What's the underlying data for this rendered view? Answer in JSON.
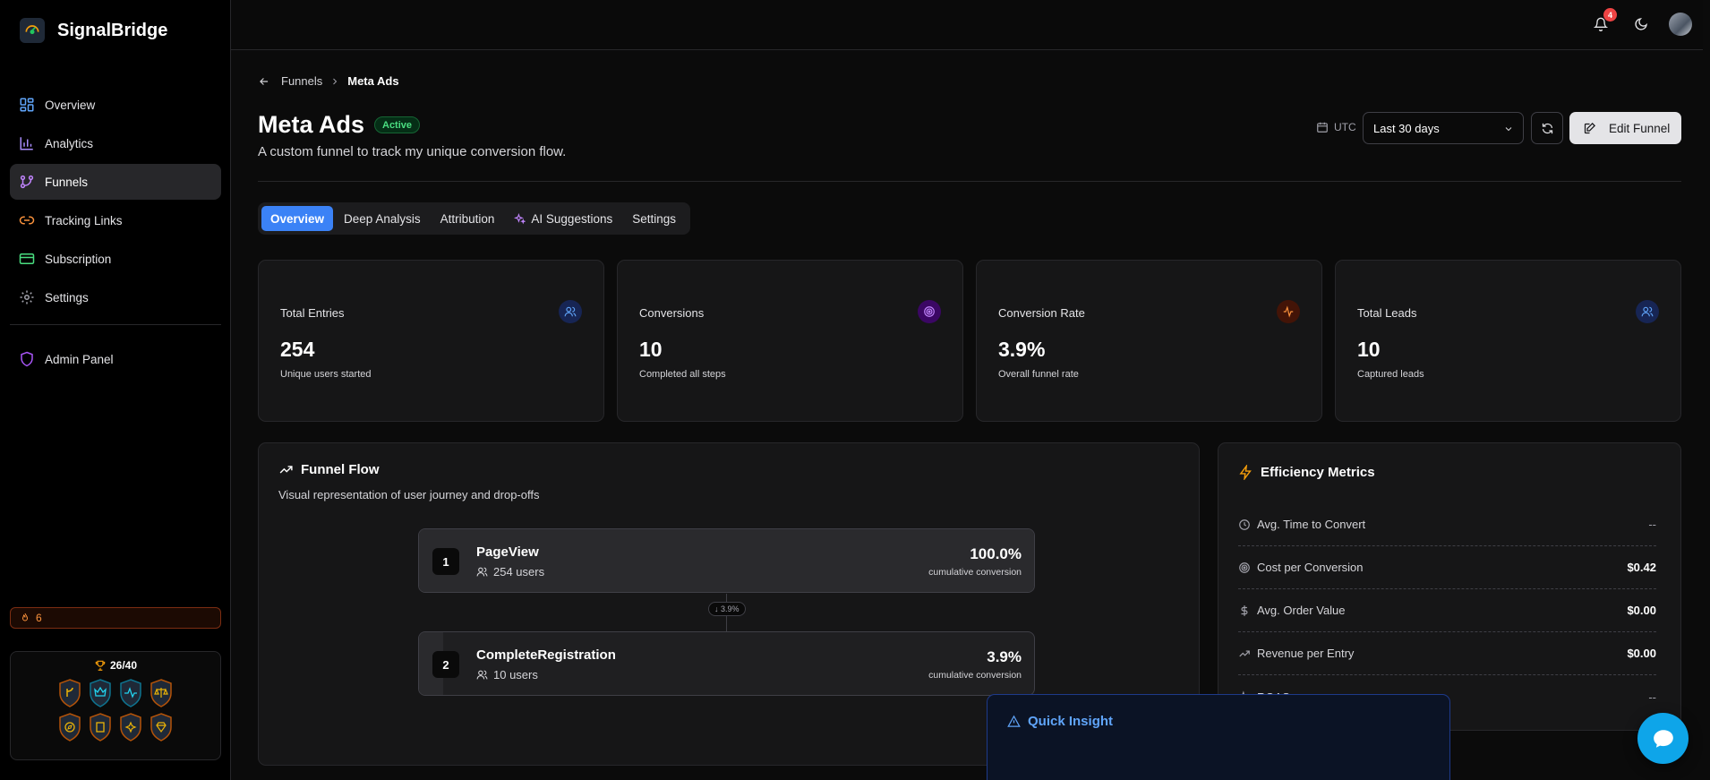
{
  "app": {
    "name": "SignalBridge"
  },
  "sidebar": {
    "items": [
      {
        "label": "Overview",
        "icon": "dashboard-icon",
        "color": "#60a5fa"
      },
      {
        "label": "Analytics",
        "icon": "bar-chart-icon",
        "color": "#a78bfa"
      },
      {
        "label": "Funnels",
        "icon": "git-branch-icon",
        "color": "#c084fc"
      },
      {
        "label": "Tracking Links",
        "icon": "link-icon",
        "color": "#fb923c"
      },
      {
        "label": "Subscription",
        "icon": "credit-card-icon",
        "color": "#4ade80"
      },
      {
        "label": "Settings",
        "icon": "gear-icon",
        "color": "#a1a1aa"
      }
    ],
    "admin": {
      "label": "Admin Panel",
      "icon": "shield-icon",
      "color": "#a855f7"
    },
    "streak": {
      "count": "6"
    },
    "achievements": {
      "count": "26/40"
    }
  },
  "topbar": {
    "notifications": "4"
  },
  "breadcrumb": {
    "parent": "Funnels",
    "current": "Meta Ads"
  },
  "page": {
    "title": "Meta Ads",
    "status": "Active",
    "description": "A custom funnel to track my unique conversion flow."
  },
  "controls": {
    "timezone": "UTC",
    "date_range": "Last 30 days",
    "edit_label": "Edit Funnel"
  },
  "tabs": [
    {
      "label": "Overview",
      "active": true
    },
    {
      "label": "Deep Analysis"
    },
    {
      "label": "Attribution"
    },
    {
      "label": "AI Suggestions"
    },
    {
      "label": "Settings"
    }
  ],
  "stats": [
    {
      "label": "Total Entries",
      "value": "254",
      "sub": "Unique users started",
      "icon": "users-icon",
      "color": "#60a5fa"
    },
    {
      "label": "Conversions",
      "value": "10",
      "sub": "Completed all steps",
      "icon": "target-icon",
      "color": "#c084fc"
    },
    {
      "label": "Conversion Rate",
      "value": "3.9%",
      "sub": "Overall funnel rate",
      "icon": "activity-icon",
      "color": "#fb923c"
    },
    {
      "label": "Total Leads",
      "value": "10",
      "sub": "Captured leads",
      "icon": "users-icon",
      "color": "#60a5fa"
    }
  ],
  "funnel_flow": {
    "title": "Funnel Flow",
    "subtitle": "Visual representation of user journey and drop-offs",
    "steps": [
      {
        "num": "1",
        "name": "PageView",
        "users": "254 users",
        "pct": "100.0%",
        "pct_label": "cumulative conversion",
        "fill": 1.0
      },
      {
        "num": "2",
        "name": "CompleteRegistration",
        "users": "10 users",
        "pct": "3.9%",
        "pct_label": "cumulative conversion",
        "fill": 0.039
      }
    ],
    "drop_label": "↓ 3.9%"
  },
  "efficiency": {
    "title": "Efficiency Metrics",
    "rows": [
      {
        "label": "Avg. Time to Convert",
        "value": "--",
        "icon": "clock-icon"
      },
      {
        "label": "Cost per Conversion",
        "value": "$0.42",
        "icon": "target-icon"
      },
      {
        "label": "Avg. Order Value",
        "value": "$0.00",
        "icon": "dollar-icon"
      },
      {
        "label": "Revenue per Entry",
        "value": "$0.00",
        "icon": "trending-up-icon"
      },
      {
        "label": "ROAS",
        "value": "--",
        "icon": "activity-icon"
      }
    ]
  },
  "insight": {
    "title": "Quick Insight"
  }
}
